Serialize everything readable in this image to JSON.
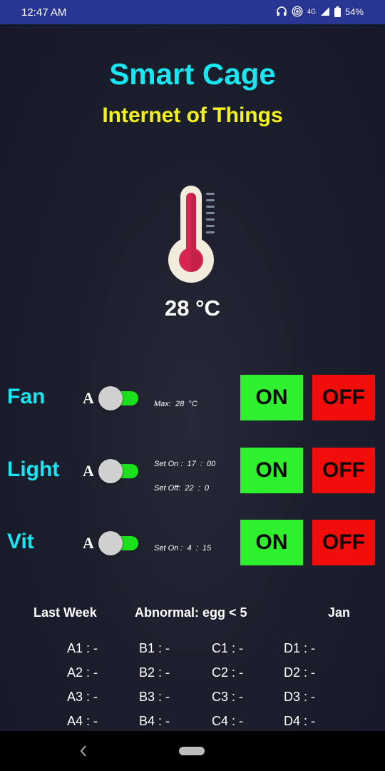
{
  "status": {
    "time": "12:47 AM",
    "network": "4G",
    "battery": "54%"
  },
  "header": {
    "title": "Smart Cage",
    "subtitle": "Internet of Things"
  },
  "temperature": {
    "value": "28 °C"
  },
  "colors": {
    "accent": "#19e6f2",
    "subtitle": "#f5f21a",
    "on": "#2ef02e",
    "off": "#f20d0d",
    "toggle": "#1de01d",
    "statusbar": "#283593"
  },
  "devices": [
    {
      "name": "Fan",
      "auto_label": "A",
      "auto_enabled": true,
      "info": [
        "Max:  28  °C"
      ],
      "on_label": "ON",
      "off_label": "OFF"
    },
    {
      "name": "Light",
      "auto_label": "A",
      "auto_enabled": true,
      "info": [
        "Set On :  17  :  00",
        "Set Off:  22  :  0"
      ],
      "on_label": "ON",
      "off_label": "OFF"
    },
    {
      "name": "Vit",
      "auto_label": "A",
      "auto_enabled": true,
      "info": [
        "Set On :  4  :  15"
      ],
      "on_label": "ON",
      "off_label": "OFF"
    }
  ],
  "summary": {
    "period": "Last Week",
    "abnormal": "Abnormal: egg < 5",
    "month": "Jan"
  },
  "cages": [
    [
      "A1 : -",
      "B1 : -",
      "C1 : -",
      "D1 : -"
    ],
    [
      "A2 : -",
      "B2 : -",
      "C2 : -",
      "D2 : -"
    ],
    [
      "A3 : -",
      "B3 : -",
      "C3 : -",
      "D3 : -"
    ],
    [
      "A4 : -",
      "B4 : -",
      "C4 : -",
      "D4 : -"
    ]
  ],
  "nav": {
    "back_icon": "back-icon",
    "home_icon": "home-pill-icon"
  }
}
